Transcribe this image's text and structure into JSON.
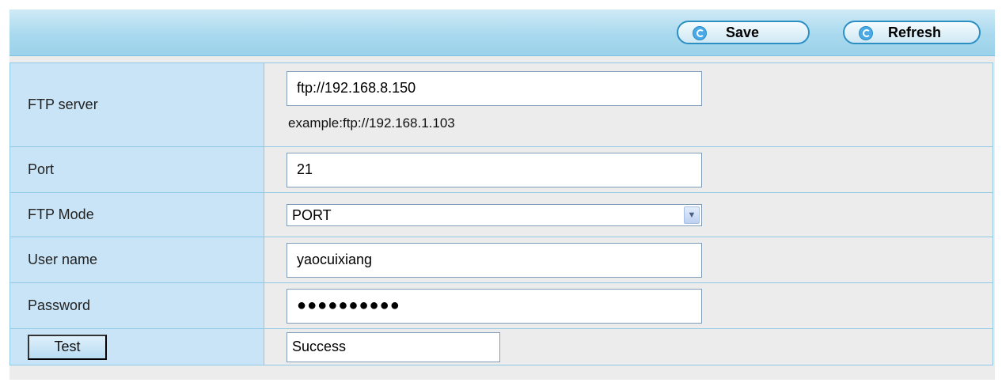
{
  "toolbar": {
    "save_label": "Save",
    "refresh_label": "Refresh"
  },
  "form": {
    "ftp_server": {
      "label": "FTP server",
      "value": "ftp://192.168.8.150",
      "hint": "example:ftp://192.168.1.103"
    },
    "port": {
      "label": "Port",
      "value": "21"
    },
    "ftp_mode": {
      "label": "FTP Mode",
      "value": "PORT"
    },
    "user_name": {
      "label": "User name",
      "value": "yaocuixiang"
    },
    "password": {
      "label": "Password",
      "masked": "●●●●●●●●●●"
    },
    "test": {
      "button_label": "Test",
      "result": "Success"
    }
  },
  "colors": {
    "toolbar_bg": "#a9d9ee",
    "label_bg": "#c9e4f6",
    "border": "#8ec9e6",
    "button_border": "#2b8fc4"
  }
}
